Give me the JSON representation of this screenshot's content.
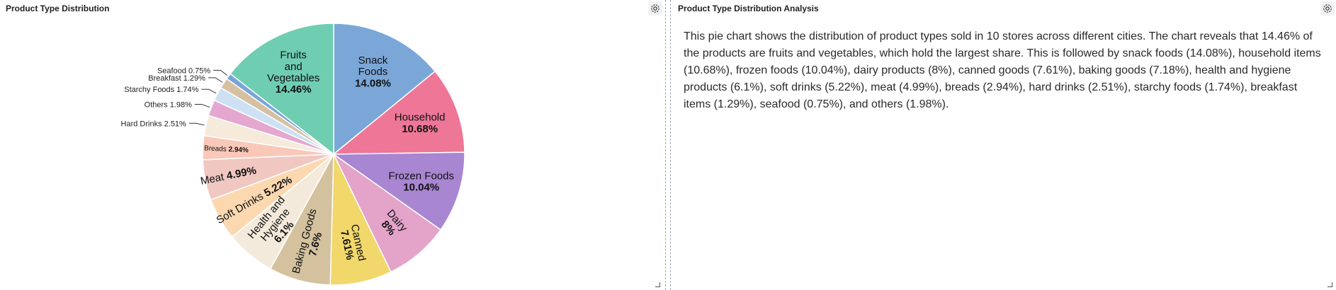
{
  "left_panel": {
    "title": "Product Type Distribution",
    "settings_icon": "gear-icon"
  },
  "right_panel": {
    "title": "Product Type Distribution Analysis",
    "settings_icon": "gear-icon",
    "text": "This pie chart shows the distribution of product types sold in 10 stores across different cities. The chart reveals that 14.46% of the products are fruits and vegetables, which hold the largest share. This is followed by snack foods (14.08%), household items (10.68%), frozen foods (10.04%), dairy products (8%), canned goods (7.61%), baking goods (7.18%), health and hygiene products (6.1%), soft drinks (5.22%), meat (4.99%), breads (2.94%), hard drinks (2.51%), starchy foods (1.74%), breakfast items (1.29%), seafood (0.75%), and others (1.98%)."
  },
  "chart_data": {
    "type": "pie",
    "title": "",
    "start": "12 o'clock, clockwise",
    "slices": [
      {
        "name": "Snack Foods",
        "label": "Snack\nFoods",
        "value_label": "14.08%",
        "value": 14.08,
        "color": "#7ba7d8"
      },
      {
        "name": "Household",
        "label": "Household",
        "value_label": "10.68%",
        "value": 10.68,
        "color": "#ee7697"
      },
      {
        "name": "Frozen Foods",
        "label": "Frozen Foods",
        "value_label": "10.04%",
        "value": 10.04,
        "color": "#a886d2"
      },
      {
        "name": "Dairy",
        "label": "Dairy",
        "value_label": "8%",
        "value": 8,
        "color": "#e4a3c9"
      },
      {
        "name": "Canned",
        "label": "Canned",
        "value_label": "7.61%",
        "value": 7.61,
        "color": "#f2d76b"
      },
      {
        "name": "Baking Goods",
        "label": "Baking Goods",
        "value_label": "7.6%",
        "value": 7.6,
        "color": "#d4c19e"
      },
      {
        "name": "Health and Hygiene",
        "label": "Health and\nHygiene",
        "value_label": "6.1%",
        "value": 6.1,
        "color": "#f4eadb"
      },
      {
        "name": "Soft Drinks",
        "label": "Soft Drinks",
        "value_label": "5.22%",
        "value": 5.22,
        "color": "#fcd8b0"
      },
      {
        "name": "Meat",
        "label": "Meat",
        "value_label": "4.99%",
        "value": 4.99,
        "color": "#f0c7c1"
      },
      {
        "name": "Breads",
        "label": "Breads",
        "value_label": "2.94%",
        "value": 2.94,
        "color": "#f9c8b9"
      },
      {
        "name": "Hard Drinks",
        "label": "Hard Drinks",
        "value_label": "2.51%",
        "value": 2.51,
        "color": "#f6eadb"
      },
      {
        "name": "Others",
        "label": "Others",
        "value_label": "1.98%",
        "value": 1.98,
        "color": "#e4a8d0"
      },
      {
        "name": "Starchy Foods",
        "label": "Starchy Foods",
        "value_label": "1.74%",
        "value": 1.74,
        "color": "#cde0f4"
      },
      {
        "name": "Breakfast",
        "label": "Breakfast",
        "value_label": "1.29%",
        "value": 1.29,
        "color": "#d6c0a2"
      },
      {
        "name": "Seafood",
        "label": "Seafood",
        "value_label": "0.75%",
        "value": 0.75,
        "color": "#79a5d6"
      },
      {
        "name": "Fruits and Vegetables",
        "label": "Fruits\nand\nVegetables",
        "value_label": "14.46%",
        "value": 14.46,
        "color": "#6fcdb2"
      }
    ]
  }
}
